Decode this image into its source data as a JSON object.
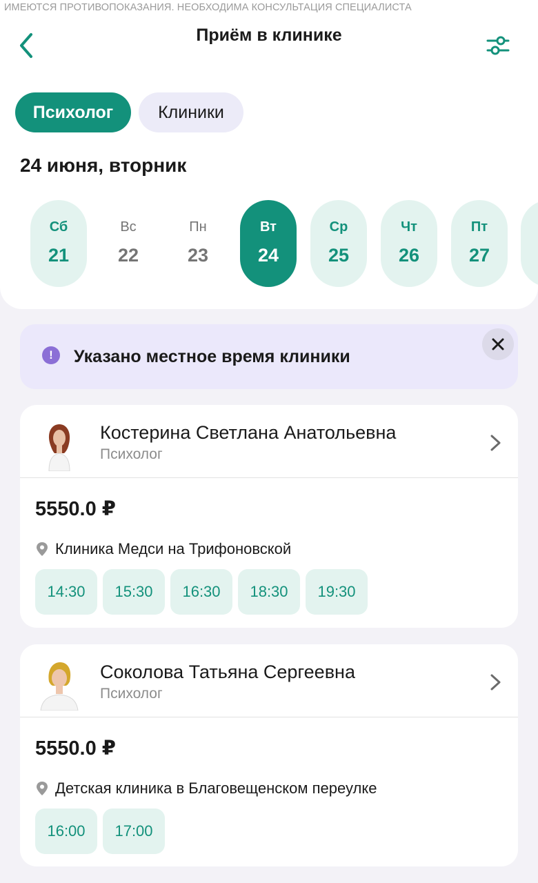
{
  "disclaimer": "ИМЕЮТСЯ ПРОТИВОПОКАЗАНИЯ. НЕОБХОДИМА КОНСУЛЬТАЦИЯ СПЕЦИАЛИСТА",
  "header": {
    "title": "Приём в клинике",
    "back_icon": "chevron-left-icon",
    "filter_icon": "sliders-icon"
  },
  "chips": [
    {
      "label": "Психолог",
      "active": true
    },
    {
      "label": "Клиники",
      "active": false
    }
  ],
  "date_heading": "24 июня, вторник",
  "days": [
    {
      "name": "Сб",
      "num": "21",
      "state": "available"
    },
    {
      "name": "Вс",
      "num": "22",
      "state": "unavailable"
    },
    {
      "name": "Пн",
      "num": "23",
      "state": "unavailable"
    },
    {
      "name": "Вт",
      "num": "24",
      "state": "selected"
    },
    {
      "name": "Ср",
      "num": "25",
      "state": "available"
    },
    {
      "name": "Чт",
      "num": "26",
      "state": "available"
    },
    {
      "name": "Пт",
      "num": "27",
      "state": "available"
    }
  ],
  "notice": {
    "text": "Указано местное время клиники",
    "icon": "exclamation-icon",
    "close_icon": "close-icon"
  },
  "doctors": [
    {
      "name": "Костерина Светлана Анатольевна",
      "specialty": "Психолог",
      "price": "5550.0 ₽",
      "clinic": "Клиника Медси на Трифоновской",
      "slots": [
        "14:30",
        "15:30",
        "16:30",
        "18:30",
        "19:30"
      ]
    },
    {
      "name": "Соколова Татьяна Сергеевна",
      "specialty": "Психолог",
      "price": "5550.0 ₽",
      "clinic": "Детская клиника в Благовещенском переулке",
      "slots": [
        "16:00",
        "17:00"
      ]
    }
  ],
  "colors": {
    "accent": "#13917b",
    "accent_light": "#e3f3ef",
    "notice_bg": "#ebe8fb",
    "notice_icon": "#8b6fd6",
    "page_bg": "#f3f2f7"
  }
}
